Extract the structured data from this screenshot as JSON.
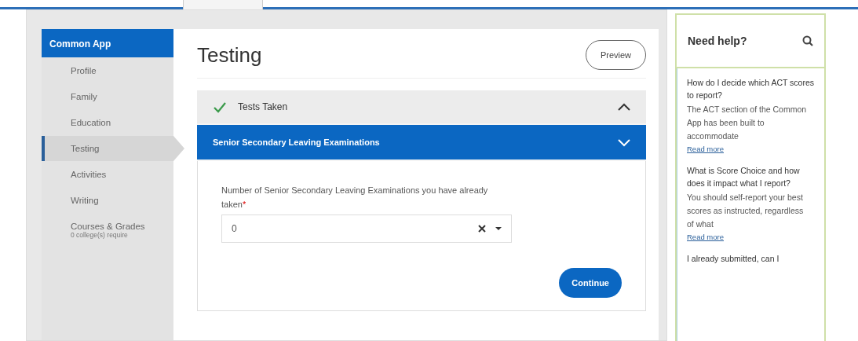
{
  "sidebar": {
    "title": "Common App",
    "items": [
      {
        "label": "Profile",
        "selected": false
      },
      {
        "label": "Family",
        "selected": false
      },
      {
        "label": "Education",
        "selected": false
      },
      {
        "label": "Testing",
        "selected": true
      },
      {
        "label": "Activities",
        "selected": false
      },
      {
        "label": "Writing",
        "selected": false
      },
      {
        "label": "Courses & Grades",
        "subtitle": "0 college(s) require",
        "selected": false
      }
    ]
  },
  "main": {
    "title": "Testing",
    "preview_button": "Preview",
    "sections": [
      {
        "title": "Tests Taken",
        "completed": true,
        "expanded": true,
        "highlighted": false
      },
      {
        "title": "Senior Secondary Leaving Examinations",
        "completed": false,
        "expanded": false,
        "highlighted": true
      }
    ],
    "question": {
      "label": "Number of Senior Secondary Leaving Examinations you have already taken",
      "required": true,
      "required_mark": "*",
      "value": "0"
    },
    "continue_button": "Continue"
  },
  "help": {
    "title": "Need help?",
    "articles": [
      {
        "question": "How do I decide which ACT scores to report?",
        "answer": "The ACT section of the Common App has been built to accommodate",
        "link": "Read more"
      },
      {
        "question": "What is Score Choice and how does it impact what I report?",
        "answer": "You should self-report your best scores as instructed, regardless of what",
        "link": "Read more"
      },
      {
        "question": "I already submitted, can I"
      }
    ]
  }
}
